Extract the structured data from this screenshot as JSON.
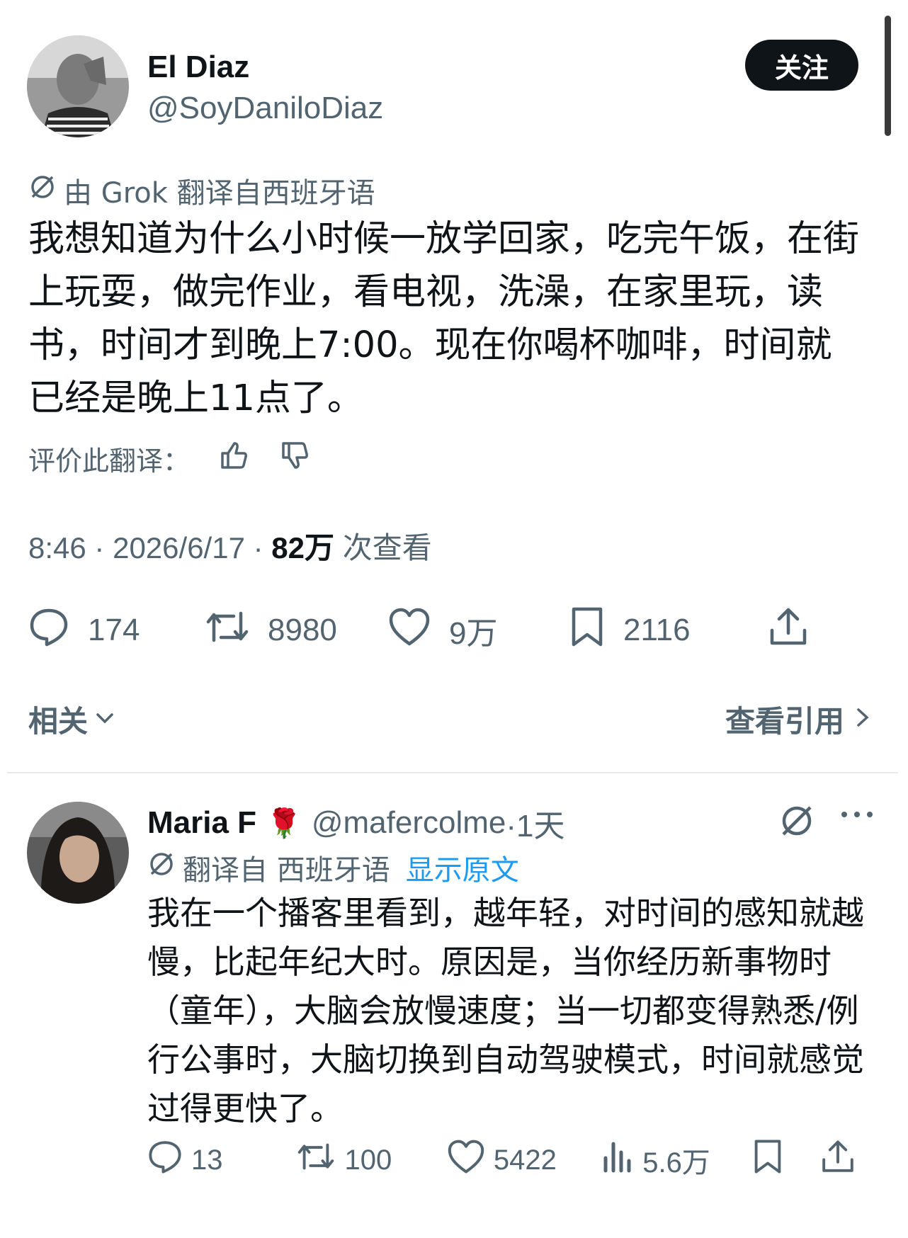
{
  "tweet": {
    "author": {
      "name": "El Diaz",
      "handle": "@SoyDaniloDiaz"
    },
    "follow_label": "关注",
    "translation_note": "由 Grok 翻译自西班牙语",
    "text": "我想知道为什么小时候一放学回家，吃完午饭，在街上玩耍，做完作业，看电视，洗澡，在家里玩，读书，时间才到晚上7:00。现在你喝杯咖啡，时间就已经是晚上11点了。",
    "rate_label": "评价此翻译：",
    "time": "8:46",
    "date": "2026/6/17",
    "views_count": "82万",
    "views_label": "次查看",
    "sep": "·",
    "actions": {
      "replies": "174",
      "reposts": "8980",
      "likes": "9万",
      "bookmarks": "2116"
    },
    "related_label": "相关",
    "quotes_label": "查看引用"
  },
  "reply": {
    "author": {
      "name": "Maria F",
      "emoji": "🌹",
      "handle": "@mafercolme",
      "time": "·1天"
    },
    "translation_note": "翻译自 西班牙语",
    "show_original": "显示原文",
    "text": "我在一个播客里看到，越年轻，对时间的感知就越慢，比起年纪大时。原因是，当你经历新事物时（童年），大脑会放慢速度；当一切都变得熟悉/例行公事时，大脑切换到自动驾驶模式，时间就感觉过得更快了。",
    "actions": {
      "replies": "13",
      "reposts": "100",
      "likes": "5422",
      "views": "5.6万"
    }
  },
  "colors": {
    "text": "#0f1419",
    "secondary": "#536471",
    "link": "#1d9bf0",
    "follow_bg": "#0f1419"
  }
}
